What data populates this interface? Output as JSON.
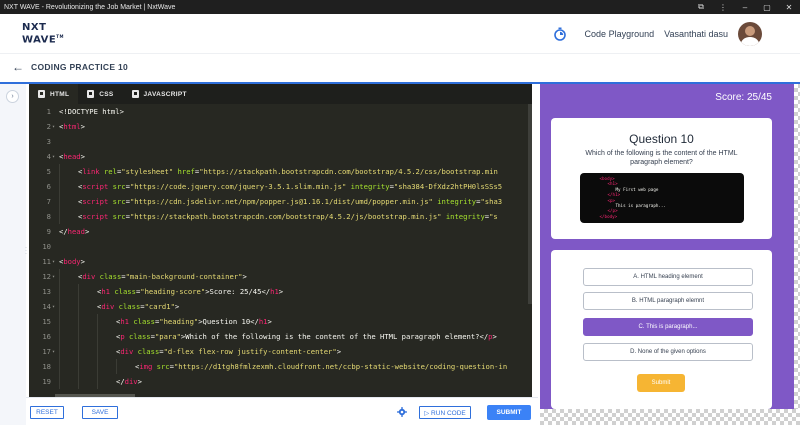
{
  "window": {
    "title": "NXT WAVE - Revolutionizing the Job Market | NxtWave",
    "controls": [
      "⧉",
      "⋮",
      "–",
      "▢",
      "✕"
    ]
  },
  "header": {
    "logo_line1": "NXT",
    "logo_line2": "WAVE",
    "logo_tm": "TM",
    "code_playground": "Code Playground",
    "user_name": "Vasanthati dasu",
    "icons": [
      "timer-icon",
      "avatar"
    ]
  },
  "page": {
    "back_icon": "←",
    "title": "CODING PRACTICE 10"
  },
  "editor": {
    "tabs": [
      {
        "label": "HTML",
        "icon": "html-file-icon",
        "active": true
      },
      {
        "label": "CSS",
        "icon": "css-file-icon",
        "active": false
      },
      {
        "label": "JAVASCRIPT",
        "icon": "js-file-icon",
        "active": false
      }
    ],
    "lines": [
      {
        "n": "1",
        "fold": "",
        "indent": 0,
        "parts": [
          [
            "pl",
            "<!DOCTYPE html>"
          ]
        ]
      },
      {
        "n": "2",
        "fold": "▾",
        "indent": 0,
        "parts": [
          [
            "pl",
            "<"
          ],
          [
            "tg",
            "html"
          ],
          [
            "pl",
            ">"
          ]
        ]
      },
      {
        "n": "3",
        "fold": "",
        "indent": 0,
        "parts": []
      },
      {
        "n": "4",
        "fold": "▾",
        "indent": 0,
        "parts": [
          [
            "pl",
            "<"
          ],
          [
            "tg",
            "head"
          ],
          [
            "pl",
            ">"
          ]
        ]
      },
      {
        "n": "5",
        "fold": "",
        "indent": 1,
        "parts": [
          [
            "pl",
            "<"
          ],
          [
            "tg",
            "link"
          ],
          [
            "pl",
            " "
          ],
          [
            "at",
            "rel"
          ],
          [
            "pl",
            "="
          ],
          [
            "st",
            "\"stylesheet\""
          ],
          [
            "pl",
            " "
          ],
          [
            "at",
            "href"
          ],
          [
            "pl",
            "="
          ],
          [
            "st",
            "\"https://stackpath.bootstrapcdn.com/bootstrap/4.5.2/css/bootstrap.min"
          ]
        ]
      },
      {
        "n": "6",
        "fold": "",
        "indent": 1,
        "parts": [
          [
            "pl",
            "<"
          ],
          [
            "tg",
            "script"
          ],
          [
            "pl",
            " "
          ],
          [
            "at",
            "src"
          ],
          [
            "pl",
            "="
          ],
          [
            "st",
            "\"https://code.jquery.com/jquery-3.5.1.slim.min.js\""
          ],
          [
            "pl",
            " "
          ],
          [
            "at",
            "integrity"
          ],
          [
            "pl",
            "="
          ],
          [
            "st",
            "\"sha384-DfXdz2htPH0lsSSs5"
          ]
        ]
      },
      {
        "n": "7",
        "fold": "",
        "indent": 1,
        "parts": [
          [
            "pl",
            "<"
          ],
          [
            "tg",
            "script"
          ],
          [
            "pl",
            " "
          ],
          [
            "at",
            "src"
          ],
          [
            "pl",
            "="
          ],
          [
            "st",
            "\"https://cdn.jsdelivr.net/npm/popper.js@1.16.1/dist/umd/popper.min.js\""
          ],
          [
            "pl",
            " "
          ],
          [
            "at",
            "integrity"
          ],
          [
            "pl",
            "="
          ],
          [
            "st",
            "\"sha3"
          ]
        ]
      },
      {
        "n": "8",
        "fold": "",
        "indent": 1,
        "parts": [
          [
            "pl",
            "<"
          ],
          [
            "tg",
            "script"
          ],
          [
            "pl",
            " "
          ],
          [
            "at",
            "src"
          ],
          [
            "pl",
            "="
          ],
          [
            "st",
            "\"https://stackpath.bootstrapcdn.com/bootstrap/4.5.2/js/bootstrap.min.js\""
          ],
          [
            "pl",
            " "
          ],
          [
            "at",
            "integrity"
          ],
          [
            "pl",
            "="
          ],
          [
            "st",
            "\"s"
          ]
        ]
      },
      {
        "n": "9",
        "fold": "",
        "indent": 0,
        "parts": [
          [
            "pl",
            "</"
          ],
          [
            "tg",
            "head"
          ],
          [
            "pl",
            ">"
          ]
        ]
      },
      {
        "n": "10",
        "fold": "",
        "indent": 0,
        "parts": []
      },
      {
        "n": "11",
        "fold": "▾",
        "indent": 0,
        "parts": [
          [
            "pl",
            "<"
          ],
          [
            "tg",
            "body"
          ],
          [
            "pl",
            ">"
          ]
        ]
      },
      {
        "n": "12",
        "fold": "▾",
        "indent": 1,
        "parts": [
          [
            "pl",
            "<"
          ],
          [
            "tg",
            "div"
          ],
          [
            "pl",
            " "
          ],
          [
            "at",
            "class"
          ],
          [
            "pl",
            "="
          ],
          [
            "st",
            "\"main-background-container\""
          ],
          [
            "pl",
            ">"
          ]
        ]
      },
      {
        "n": "13",
        "fold": "",
        "indent": 2,
        "parts": [
          [
            "pl",
            "<"
          ],
          [
            "tg",
            "h1"
          ],
          [
            "pl",
            " "
          ],
          [
            "at",
            "class"
          ],
          [
            "pl",
            "="
          ],
          [
            "st",
            "\"heading-score\""
          ],
          [
            "pl",
            ">Score: 25/45</"
          ],
          [
            "tg",
            "h1"
          ],
          [
            "pl",
            ">"
          ]
        ]
      },
      {
        "n": "14",
        "fold": "▾",
        "indent": 2,
        "parts": [
          [
            "pl",
            "<"
          ],
          [
            "tg",
            "div"
          ],
          [
            "pl",
            " "
          ],
          [
            "at",
            "class"
          ],
          [
            "pl",
            "="
          ],
          [
            "st",
            "\"card1\""
          ],
          [
            "pl",
            ">"
          ]
        ]
      },
      {
        "n": "15",
        "fold": "",
        "indent": 3,
        "parts": [
          [
            "pl",
            "<"
          ],
          [
            "tg",
            "h1"
          ],
          [
            "pl",
            " "
          ],
          [
            "at",
            "class"
          ],
          [
            "pl",
            "="
          ],
          [
            "st",
            "\"heading\""
          ],
          [
            "pl",
            ">Question 10</"
          ],
          [
            "tg",
            "h1"
          ],
          [
            "pl",
            ">"
          ]
        ]
      },
      {
        "n": "16",
        "fold": "",
        "indent": 3,
        "parts": [
          [
            "pl",
            "<"
          ],
          [
            "tg",
            "p"
          ],
          [
            "pl",
            " "
          ],
          [
            "at",
            "class"
          ],
          [
            "pl",
            "="
          ],
          [
            "st",
            "\"para\""
          ],
          [
            "pl",
            ">Which of the following is the content of the HTML paragraph element?</"
          ],
          [
            "tg",
            "p"
          ],
          [
            "pl",
            ">"
          ]
        ]
      },
      {
        "n": "17",
        "fold": "▾",
        "indent": 3,
        "parts": [
          [
            "pl",
            "<"
          ],
          [
            "tg",
            "div"
          ],
          [
            "pl",
            " "
          ],
          [
            "at",
            "class"
          ],
          [
            "pl",
            "="
          ],
          [
            "st",
            "\"d-flex flex-row justify-content-center\""
          ],
          [
            "pl",
            ">"
          ]
        ]
      },
      {
        "n": "18",
        "fold": "",
        "indent": 4,
        "parts": [
          [
            "pl",
            "<"
          ],
          [
            "tg",
            "img"
          ],
          [
            "pl",
            " "
          ],
          [
            "at",
            "src"
          ],
          [
            "pl",
            "="
          ],
          [
            "st",
            "\"https://d1tgh8fmlzexmh.cloudfront.net/ccbp-static-website/coding-question-in"
          ]
        ]
      },
      {
        "n": "19",
        "fold": "",
        "indent": 3,
        "parts": [
          [
            "pl",
            "</"
          ],
          [
            "tg",
            "div"
          ],
          [
            "pl",
            ">"
          ]
        ]
      }
    ]
  },
  "bottom_bar": {
    "reset": "RESET",
    "save": "SAVE",
    "run_code": "▷ RUN CODE",
    "submit": "SUBMIT"
  },
  "preview": {
    "score": "Score: 25/45",
    "question_heading": "Question 10",
    "question_para": "Which of the following is the content of the HTML paragraph element?",
    "code_image_lines": [
      {
        "indent": 0,
        "tag": "<body>",
        "text": ""
      },
      {
        "indent": 1,
        "tag": "<h1>",
        "text": ""
      },
      {
        "indent": 2,
        "tag": "",
        "text": "My First web page"
      },
      {
        "indent": 1,
        "tag": "</h1>",
        "text": ""
      },
      {
        "indent": 1,
        "tag": "<p>",
        "text": ""
      },
      {
        "indent": 2,
        "tag": "",
        "text": "This is paragraph..."
      },
      {
        "indent": 1,
        "tag": "</p>",
        "text": ""
      },
      {
        "indent": 0,
        "tag": "</body>",
        "text": ""
      }
    ],
    "options": [
      {
        "label": "A. HTML heading element",
        "selected": false
      },
      {
        "label": "B. HTML paragraph elemnt",
        "selected": false
      },
      {
        "label": "C. This is paragraph...",
        "selected": true
      },
      {
        "label": "D. None of the given options",
        "selected": false
      }
    ],
    "submit_label": "Submit"
  },
  "colors": {
    "accent_blue": "#2f6fdb",
    "preview_purple": "#7f58c6",
    "submit_yellow": "#f6b533",
    "editor_bg": "#272822"
  }
}
